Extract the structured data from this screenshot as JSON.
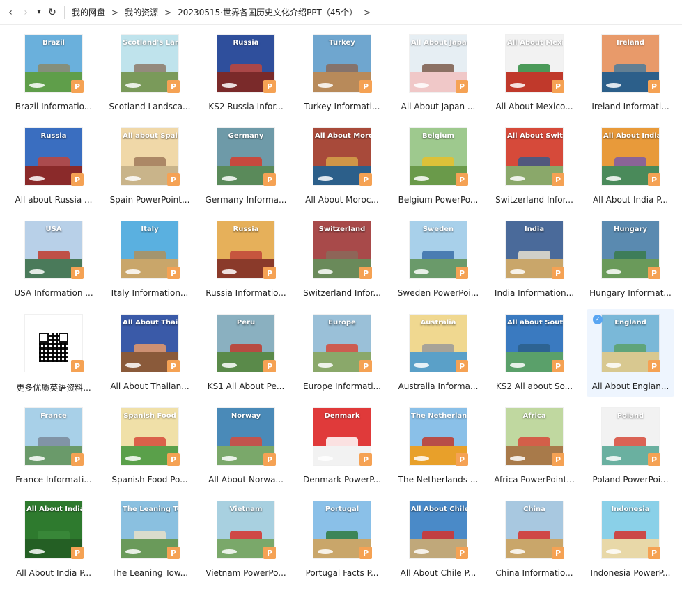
{
  "nav": {
    "back_icon": "chevron-left-icon",
    "forward_icon": "chevron-right-icon",
    "history_icon": "caret-down-icon",
    "refresh_icon": "refresh-icon",
    "back_glyph": "‹",
    "forward_glyph": "›",
    "history_glyph": "▾",
    "refresh_glyph": "↻"
  },
  "breadcrumb": {
    "items": [
      "我的网盘",
      "我的资源",
      "20230515·世界各国历史文化介绍PPT（45个）"
    ],
    "separator": ">"
  },
  "badge_letter": "P",
  "files": [
    {
      "label": "Brazil Informatio...",
      "thumb_title": "Brazil",
      "bg": "#6ab0dc",
      "ground": "#5f9e4a",
      "accent": "#8a8a6a"
    },
    {
      "label": "Scotland Landsca...",
      "thumb_title": "Scotland's Landscape",
      "bg": "#bfe3ec",
      "ground": "#7a9a5a",
      "accent": "#8c7a6a"
    },
    {
      "label": "KS2 Russia Infor...",
      "thumb_title": "Russia",
      "bg": "#2f4f9c",
      "ground": "#7a2a2a",
      "accent": "#c0453a"
    },
    {
      "label": "Turkey Informati...",
      "thumb_title": "Turkey",
      "bg": "#6fa6cf",
      "ground": "#b88a5a",
      "accent": "#8a6a5a"
    },
    {
      "label": "All About Japan ...",
      "thumb_title": "All About Japan",
      "bg": "#e6eef3",
      "ground": "#f0c8c8",
      "accent": "#7a5a4a"
    },
    {
      "label": "All About Mexico...",
      "thumb_title": "All About Mexico",
      "bg": "#f2f2f2",
      "ground": "#c0392b",
      "accent": "#2e8b3e"
    },
    {
      "label": "Ireland Informati...",
      "thumb_title": "Ireland",
      "bg": "#e89a6a",
      "ground": "#2c5f8a",
      "accent": "#4a7a9a"
    },
    {
      "label": "All about Russia ...",
      "thumb_title": "Russia",
      "bg": "#3a6ec0",
      "ground": "#8a2a2a",
      "accent": "#c0453a"
    },
    {
      "label": "Spain PowerPoint...",
      "thumb_title": "All about Spain",
      "bg": "#f0d8a8",
      "ground": "#c9b48a",
      "accent": "#a07a5a"
    },
    {
      "label": "Germany Informa...",
      "thumb_title": "Germany",
      "bg": "#6e9aa8",
      "ground": "#5a8a5a",
      "accent": "#d63c2c"
    },
    {
      "label": "All About Moroc...",
      "thumb_title": "All About Morocco",
      "bg": "#a84a3a",
      "ground": "#2c5f8a",
      "accent": "#d6a24a"
    },
    {
      "label": "Belgium PowerPo...",
      "thumb_title": "Belgium",
      "bg": "#9ec98e",
      "ground": "#6a9a4a",
      "accent": "#e6c02a"
    },
    {
      "label": "Switzerland Infor...",
      "thumb_title": "All About Switzerland",
      "bg": "#d64a3a",
      "ground": "#8aa86a",
      "accent": "#3a5a8a"
    },
    {
      "label": "All About India P...",
      "thumb_title": "All About India",
      "bg": "#e89a3a",
      "ground": "#4a8a5a",
      "accent": "#7a5aa8"
    },
    {
      "label": "USA Information ...",
      "thumb_title": "USA",
      "bg": "#b8d0e8",
      "ground": "#4a7a5a",
      "accent": "#c0392b"
    },
    {
      "label": "Italy Information...",
      "thumb_title": "Italy",
      "bg": "#5ab0e0",
      "ground": "#c9a66a",
      "accent": "#b0905a"
    },
    {
      "label": "Russia Informatio...",
      "thumb_title": "Russia",
      "bg": "#e6b05a",
      "ground": "#8a3a2a",
      "accent": "#c0453a"
    },
    {
      "label": "Switzerland Infor...",
      "thumb_title": "Switzerland",
      "bg": "#a84a4a",
      "ground": "#6a8a5a",
      "accent": "#8a6a5a"
    },
    {
      "label": "Sweden PowerPoi...",
      "thumb_title": "Sweden",
      "bg": "#a8d0ea",
      "ground": "#6a9a6a",
      "accent": "#3a6ea8"
    },
    {
      "label": "India Information...",
      "thumb_title": "India",
      "bg": "#4a6a9a",
      "ground": "#c9a66a",
      "accent": "#e8e0d0"
    },
    {
      "label": "Hungary Informat...",
      "thumb_title": "Hungary",
      "bg": "#5a8ab0",
      "ground": "#6a9a5a",
      "accent": "#3a7a4a"
    },
    {
      "label": "更多优质英语资料...",
      "thumb_title": "",
      "bg": "#ffffff",
      "ground": "#ffffff",
      "accent": "#ffffff",
      "qr": true
    },
    {
      "label": "All About Thailan...",
      "thumb_title": "All About Thailand",
      "bg": "#3a5aa8",
      "ground": "#8a5a3a",
      "accent": "#e89a6a"
    },
    {
      "label": "KS1 All About Pe...",
      "thumb_title": "Peru",
      "bg": "#8ab0c0",
      "ground": "#5a8a4a",
      "accent": "#c0392b"
    },
    {
      "label": "Europe Informati...",
      "thumb_title": "Europe",
      "bg": "#9ac0d8",
      "ground": "#8aa86a",
      "accent": "#d64a3a"
    },
    {
      "label": "Australia Informa...",
      "thumb_title": "Australia",
      "bg": "#f0d890",
      "ground": "#5aa0c8",
      "accent": "#9a9a9a"
    },
    {
      "label": "KS2 All about So...",
      "thumb_title": "All about South Korea",
      "bg": "#3a7ac0",
      "ground": "#5aa06a",
      "accent": "#2c5f8a"
    },
    {
      "label": "All About Englan...",
      "thumb_title": "England",
      "bg": "#7ab8d8",
      "ground": "#d8c890",
      "accent": "#5aa06a",
      "selected": true
    },
    {
      "label": "France Informati...",
      "thumb_title": "France",
      "bg": "#a8d0e8",
      "ground": "#6a9a6a",
      "accent": "#7a8a9a"
    },
    {
      "label": "Spanish Food Po...",
      "thumb_title": "Spanish Food",
      "bg": "#f0e0a8",
      "ground": "#5aa04a",
      "accent": "#d64a3a"
    },
    {
      "label": "All About Norwa...",
      "thumb_title": "Norway",
      "bg": "#4a8ab8",
      "ground": "#7aa86a",
      "accent": "#d64a3a"
    },
    {
      "label": "Denmark PowerP...",
      "thumb_title": "Denmark",
      "bg": "#e03a3a",
      "ground": "#f2f2f2",
      "accent": "#ffffff"
    },
    {
      "label": "The Netherlands ...",
      "thumb_title": "The Netherlands",
      "bg": "#8ac0e8",
      "ground": "#e8a02a",
      "accent": "#c0392b"
    },
    {
      "label": "Africa PowerPoint...",
      "thumb_title": "Africa",
      "bg": "#c0d8a0",
      "ground": "#a87a4a",
      "accent": "#d64a3a"
    },
    {
      "label": "Poland PowerPoi...",
      "thumb_title": "Poland",
      "bg": "#f2f2f2",
      "ground": "#6ab0a0",
      "accent": "#d64a3a"
    },
    {
      "label": "All About India P...",
      "thumb_title": "All About India",
      "bg": "#2e7a2e",
      "ground": "#245f24",
      "accent": "#3a8a3a"
    },
    {
      "label": "The Leaning Tow...",
      "thumb_title": "The Leaning Tower of Pisa",
      "bg": "#8ac0e0",
      "ground": "#6a9a5a",
      "accent": "#e8e0c8"
    },
    {
      "label": "Vietnam PowerPo...",
      "thumb_title": "Vietnam",
      "bg": "#a8d0e0",
      "ground": "#7aa86a",
      "accent": "#d6302a"
    },
    {
      "label": "Portugal Facts P...",
      "thumb_title": "Portugal",
      "bg": "#8ac0e8",
      "ground": "#c9a66a",
      "accent": "#2e7a3e"
    },
    {
      "label": "All About Chile P...",
      "thumb_title": "All About Chile",
      "bg": "#4a8ac8",
      "ground": "#c0a87a",
      "accent": "#d6302a"
    },
    {
      "label": "China Informatio...",
      "thumb_title": "China",
      "bg": "#a8c8e0",
      "ground": "#c9a66a",
      "accent": "#d6302a"
    },
    {
      "label": "Indonesia PowerP...",
      "thumb_title": "Indonesia",
      "bg": "#8ad0e8",
      "ground": "#e8d8a8",
      "accent": "#d6302a"
    }
  ]
}
